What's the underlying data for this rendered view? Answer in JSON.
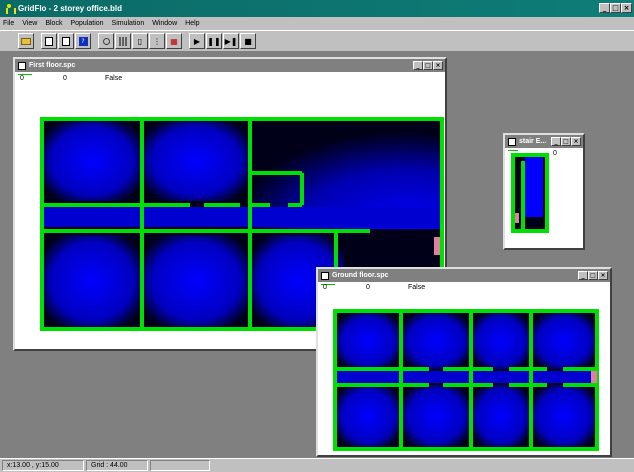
{
  "app": {
    "title": "GridFlo - 2 storey office.bld",
    "menu": [
      "File",
      "View",
      "Block",
      "Population",
      "Simulation",
      "Window",
      "Help"
    ],
    "window_buttons": [
      "_",
      "□",
      "×"
    ]
  },
  "toolbar": {
    "buttons": [
      "open",
      "new",
      "page",
      "blue-block",
      "zoom",
      "grid",
      "col",
      "row",
      "population",
      "play",
      "pause",
      "step",
      "stop"
    ]
  },
  "windows": {
    "first_floor": {
      "title": "First floor.spc",
      "val1": "0",
      "val2": "0",
      "val3": "False"
    },
    "ground_floor": {
      "title": "Ground floor.spc",
      "val1": "0",
      "val2": "0",
      "val3": "False"
    },
    "stair": {
      "title": "stair E...",
      "val1": "0"
    }
  },
  "status": {
    "coords": "x:13.00 , y:15.00",
    "grid": "Grid : 44.00",
    "extra": ""
  },
  "colors": {
    "wall": "#00e000",
    "deep": "#000020",
    "blue": "#0000ff",
    "exit": "#e080a0"
  }
}
